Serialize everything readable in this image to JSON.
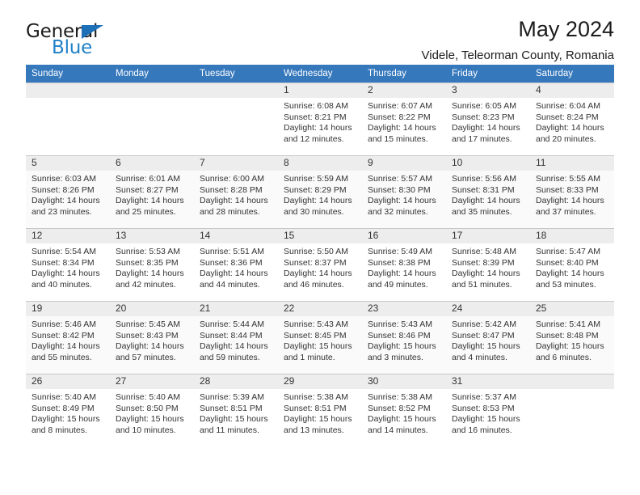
{
  "brand": {
    "name_top": "General",
    "name_bottom": "Blue",
    "triangle_icon": "blue-triangle-icon",
    "accent_color": "#2081c8"
  },
  "header": {
    "title": "May 2024",
    "subtitle": "Videle, Teleorman County, Romania"
  },
  "calendar": {
    "header_bg": "#3678bc",
    "weekday_headers": [
      "Sunday",
      "Monday",
      "Tuesday",
      "Wednesday",
      "Thursday",
      "Friday",
      "Saturday"
    ],
    "weeks": [
      [
        {
          "day": "",
          "lines": []
        },
        {
          "day": "",
          "lines": []
        },
        {
          "day": "",
          "lines": []
        },
        {
          "day": "1",
          "lines": [
            "Sunrise: 6:08 AM",
            "Sunset: 8:21 PM",
            "Daylight: 14 hours",
            "and 12 minutes."
          ]
        },
        {
          "day": "2",
          "lines": [
            "Sunrise: 6:07 AM",
            "Sunset: 8:22 PM",
            "Daylight: 14 hours",
            "and 15 minutes."
          ]
        },
        {
          "day": "3",
          "lines": [
            "Sunrise: 6:05 AM",
            "Sunset: 8:23 PM",
            "Daylight: 14 hours",
            "and 17 minutes."
          ]
        },
        {
          "day": "4",
          "lines": [
            "Sunrise: 6:04 AM",
            "Sunset: 8:24 PM",
            "Daylight: 14 hours",
            "and 20 minutes."
          ]
        }
      ],
      [
        {
          "day": "5",
          "lines": [
            "Sunrise: 6:03 AM",
            "Sunset: 8:26 PM",
            "Daylight: 14 hours",
            "and 23 minutes."
          ]
        },
        {
          "day": "6",
          "lines": [
            "Sunrise: 6:01 AM",
            "Sunset: 8:27 PM",
            "Daylight: 14 hours",
            "and 25 minutes."
          ]
        },
        {
          "day": "7",
          "lines": [
            "Sunrise: 6:00 AM",
            "Sunset: 8:28 PM",
            "Daylight: 14 hours",
            "and 28 minutes."
          ]
        },
        {
          "day": "8",
          "lines": [
            "Sunrise: 5:59 AM",
            "Sunset: 8:29 PM",
            "Daylight: 14 hours",
            "and 30 minutes."
          ]
        },
        {
          "day": "9",
          "lines": [
            "Sunrise: 5:57 AM",
            "Sunset: 8:30 PM",
            "Daylight: 14 hours",
            "and 32 minutes."
          ]
        },
        {
          "day": "10",
          "lines": [
            "Sunrise: 5:56 AM",
            "Sunset: 8:31 PM",
            "Daylight: 14 hours",
            "and 35 minutes."
          ]
        },
        {
          "day": "11",
          "lines": [
            "Sunrise: 5:55 AM",
            "Sunset: 8:33 PM",
            "Daylight: 14 hours",
            "and 37 minutes."
          ]
        }
      ],
      [
        {
          "day": "12",
          "lines": [
            "Sunrise: 5:54 AM",
            "Sunset: 8:34 PM",
            "Daylight: 14 hours",
            "and 40 minutes."
          ]
        },
        {
          "day": "13",
          "lines": [
            "Sunrise: 5:53 AM",
            "Sunset: 8:35 PM",
            "Daylight: 14 hours",
            "and 42 minutes."
          ]
        },
        {
          "day": "14",
          "lines": [
            "Sunrise: 5:51 AM",
            "Sunset: 8:36 PM",
            "Daylight: 14 hours",
            "and 44 minutes."
          ]
        },
        {
          "day": "15",
          "lines": [
            "Sunrise: 5:50 AM",
            "Sunset: 8:37 PM",
            "Daylight: 14 hours",
            "and 46 minutes."
          ]
        },
        {
          "day": "16",
          "lines": [
            "Sunrise: 5:49 AM",
            "Sunset: 8:38 PM",
            "Daylight: 14 hours",
            "and 49 minutes."
          ]
        },
        {
          "day": "17",
          "lines": [
            "Sunrise: 5:48 AM",
            "Sunset: 8:39 PM",
            "Daylight: 14 hours",
            "and 51 minutes."
          ]
        },
        {
          "day": "18",
          "lines": [
            "Sunrise: 5:47 AM",
            "Sunset: 8:40 PM",
            "Daylight: 14 hours",
            "and 53 minutes."
          ]
        }
      ],
      [
        {
          "day": "19",
          "lines": [
            "Sunrise: 5:46 AM",
            "Sunset: 8:42 PM",
            "Daylight: 14 hours",
            "and 55 minutes."
          ]
        },
        {
          "day": "20",
          "lines": [
            "Sunrise: 5:45 AM",
            "Sunset: 8:43 PM",
            "Daylight: 14 hours",
            "and 57 minutes."
          ]
        },
        {
          "day": "21",
          "lines": [
            "Sunrise: 5:44 AM",
            "Sunset: 8:44 PM",
            "Daylight: 14 hours",
            "and 59 minutes."
          ]
        },
        {
          "day": "22",
          "lines": [
            "Sunrise: 5:43 AM",
            "Sunset: 8:45 PM",
            "Daylight: 15 hours",
            "and 1 minute."
          ]
        },
        {
          "day": "23",
          "lines": [
            "Sunrise: 5:43 AM",
            "Sunset: 8:46 PM",
            "Daylight: 15 hours",
            "and 3 minutes."
          ]
        },
        {
          "day": "24",
          "lines": [
            "Sunrise: 5:42 AM",
            "Sunset: 8:47 PM",
            "Daylight: 15 hours",
            "and 4 minutes."
          ]
        },
        {
          "day": "25",
          "lines": [
            "Sunrise: 5:41 AM",
            "Sunset: 8:48 PM",
            "Daylight: 15 hours",
            "and 6 minutes."
          ]
        }
      ],
      [
        {
          "day": "26",
          "lines": [
            "Sunrise: 5:40 AM",
            "Sunset: 8:49 PM",
            "Daylight: 15 hours",
            "and 8 minutes."
          ]
        },
        {
          "day": "27",
          "lines": [
            "Sunrise: 5:40 AM",
            "Sunset: 8:50 PM",
            "Daylight: 15 hours",
            "and 10 minutes."
          ]
        },
        {
          "day": "28",
          "lines": [
            "Sunrise: 5:39 AM",
            "Sunset: 8:51 PM",
            "Daylight: 15 hours",
            "and 11 minutes."
          ]
        },
        {
          "day": "29",
          "lines": [
            "Sunrise: 5:38 AM",
            "Sunset: 8:51 PM",
            "Daylight: 15 hours",
            "and 13 minutes."
          ]
        },
        {
          "day": "30",
          "lines": [
            "Sunrise: 5:38 AM",
            "Sunset: 8:52 PM",
            "Daylight: 15 hours",
            "and 14 minutes."
          ]
        },
        {
          "day": "31",
          "lines": [
            "Sunrise: 5:37 AM",
            "Sunset: 8:53 PM",
            "Daylight: 15 hours",
            "and 16 minutes."
          ]
        },
        {
          "day": "",
          "lines": []
        }
      ]
    ]
  }
}
